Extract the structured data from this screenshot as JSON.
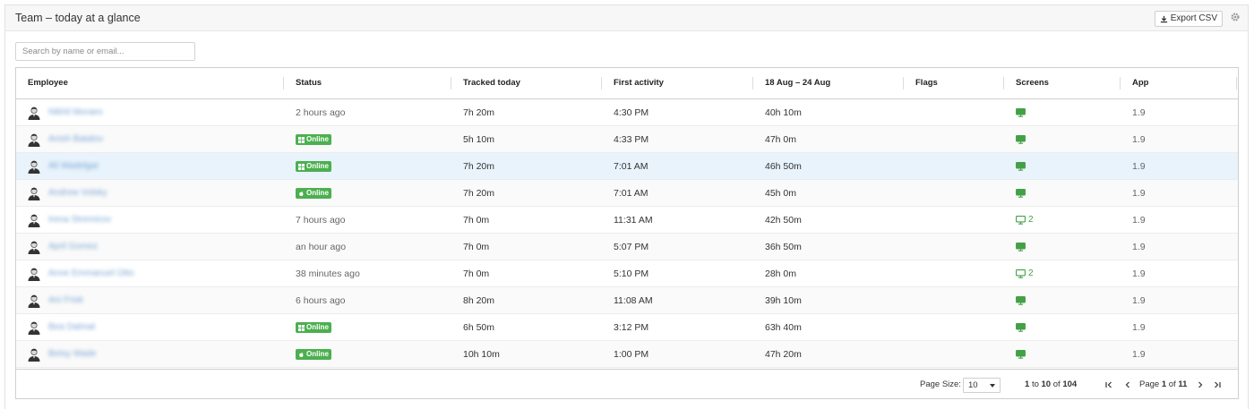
{
  "header": {
    "title": "Team – today at a glance",
    "export_label": "Export CSV"
  },
  "search": {
    "placeholder": "Search by name or email..."
  },
  "columns": [
    "Employee",
    "Status",
    "Tracked today",
    "First activity",
    "18 Aug – 24 Aug",
    "Flags",
    "Screens",
    "App"
  ],
  "online_label": "Online",
  "rows": [
    {
      "name": "Nikhil Moraes",
      "status": "2 hours ago",
      "badge_os": "",
      "tracked": "7h 20m",
      "first": "4:30 PM",
      "week": "40h 10m",
      "screens": "",
      "app": "1.9"
    },
    {
      "name": "Anish Batalov",
      "status": "",
      "badge_os": "windows",
      "tracked": "5h 10m",
      "first": "4:33 PM",
      "week": "47h 0m",
      "screens": "",
      "app": "1.9"
    },
    {
      "name": "Ali Wadelgar",
      "status": "",
      "badge_os": "windows",
      "tracked": "7h 20m",
      "first": "7:01 AM",
      "week": "46h 50m",
      "screens": "",
      "app": "1.9"
    },
    {
      "name": "Andrew Volsky",
      "status": "",
      "badge_os": "apple",
      "tracked": "7h 20m",
      "first": "7:01 AM",
      "week": "45h 0m",
      "screens": "",
      "app": "1.9"
    },
    {
      "name": "Irena Stremicov",
      "status": "7 hours ago",
      "badge_os": "",
      "tracked": "7h 0m",
      "first": "11:31 AM",
      "week": "42h 50m",
      "screens": "2",
      "app": "1.9"
    },
    {
      "name": "April Gomez",
      "status": "an hour ago",
      "badge_os": "",
      "tracked": "7h 0m",
      "first": "5:07 PM",
      "week": "36h 50m",
      "screens": "",
      "app": "1.9"
    },
    {
      "name": "Anne Emmanuel Otto",
      "status": "38 minutes ago",
      "badge_os": "",
      "tracked": "7h 0m",
      "first": "5:10 PM",
      "week": "28h 0m",
      "screens": "2",
      "app": "1.9"
    },
    {
      "name": "Ani Frisk",
      "status": "6 hours ago",
      "badge_os": "",
      "tracked": "8h 20m",
      "first": "11:08 AM",
      "week": "39h 10m",
      "screens": "",
      "app": "1.9"
    },
    {
      "name": "Bea Dalmat",
      "status": "",
      "badge_os": "windows",
      "tracked": "6h 50m",
      "first": "3:12 PM",
      "week": "63h 40m",
      "screens": "",
      "app": "1.9"
    },
    {
      "name": "Betsy Wade",
      "status": "",
      "badge_os": "apple",
      "tracked": "10h 10m",
      "first": "1:00 PM",
      "week": "47h 20m",
      "screens": "",
      "app": "1.9"
    }
  ],
  "footer": {
    "page_size_label": "Page Size:",
    "page_size_value": "10",
    "range_from": "1",
    "range_to_word": "to",
    "range_to": "10",
    "range_of_word": "of",
    "total": "104",
    "page_word": "Page",
    "page_current": "1",
    "page_of_word": "of",
    "page_total": "11"
  },
  "colors": {
    "online": "#4caf50",
    "screen": "#43a047",
    "selected_row": "#e8f3fc"
  }
}
